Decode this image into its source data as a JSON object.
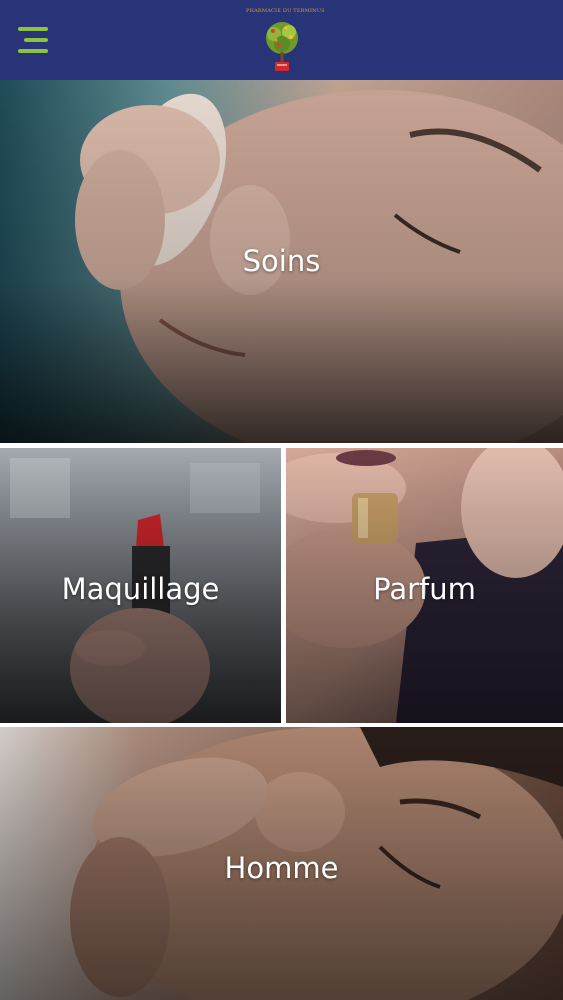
{
  "header": {
    "menu_icon": "hamburger-menu-icon",
    "logo_text": "PHARMACIE DU TERMINUS",
    "logo_icon": "tree-logo-icon",
    "background_color": "#283378",
    "menu_color": "#8bc53f"
  },
  "categories": {
    "soins": {
      "label": "Soins"
    },
    "maquillage": {
      "label": "Maquillage"
    },
    "parfum": {
      "label": "Parfum"
    },
    "homme": {
      "label": "Homme"
    }
  }
}
